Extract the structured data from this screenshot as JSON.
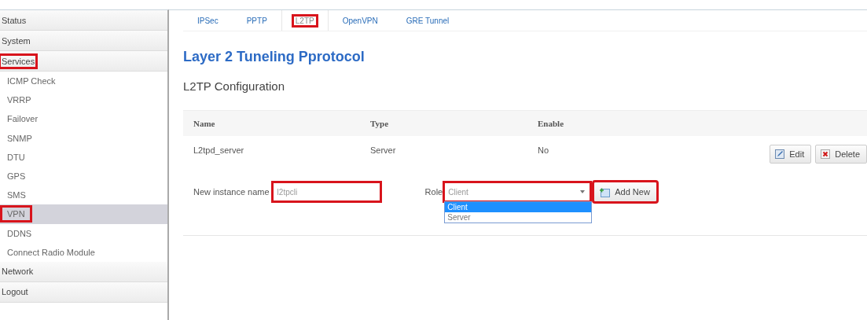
{
  "sidebar": {
    "items": [
      {
        "label": "Status",
        "selected": false,
        "highlighted": false
      },
      {
        "label": "System",
        "selected": false,
        "highlighted": false
      },
      {
        "label": "Services",
        "selected": false,
        "highlighted": true,
        "children": [
          {
            "label": "ICMP Check",
            "selected": false,
            "highlighted": false
          },
          {
            "label": "VRRP",
            "selected": false,
            "highlighted": false
          },
          {
            "label": "Failover",
            "selected": false,
            "highlighted": false
          },
          {
            "label": "SNMP",
            "selected": false,
            "highlighted": false
          },
          {
            "label": "DTU",
            "selected": false,
            "highlighted": false
          },
          {
            "label": "GPS",
            "selected": false,
            "highlighted": false
          },
          {
            "label": "SMS",
            "selected": false,
            "highlighted": false
          },
          {
            "label": "VPN",
            "selected": true,
            "highlighted": true
          },
          {
            "label": "DDNS",
            "selected": false,
            "highlighted": false
          },
          {
            "label": "Connect Radio Module",
            "selected": false,
            "highlighted": false
          }
        ]
      },
      {
        "label": "Network",
        "selected": false,
        "highlighted": false
      },
      {
        "label": "Logout",
        "selected": false,
        "highlighted": false
      }
    ]
  },
  "tabs": [
    {
      "label": "IPSec",
      "selected": false,
      "highlighted": false
    },
    {
      "label": "PPTP",
      "selected": false,
      "highlighted": false
    },
    {
      "label": "L2TP",
      "selected": true,
      "highlighted": true
    },
    {
      "label": "OpenVPN",
      "selected": false,
      "highlighted": false
    },
    {
      "label": "GRE Tunnel",
      "selected": false,
      "highlighted": false
    }
  ],
  "title": "Layer 2 Tuneling Pprotocol",
  "subtitle": "L2TP Configuration",
  "table": {
    "columns": [
      "Name",
      "Type",
      "Enable"
    ],
    "rows": [
      {
        "cells": [
          "L2tpd_server",
          "Server",
          "No"
        ],
        "actions": [
          {
            "kind": "edit",
            "label": "Edit"
          },
          {
            "kind": "delete",
            "label": "Delete"
          }
        ]
      }
    ]
  },
  "new_instance": {
    "label": "New instance name",
    "value": "l2tpcli",
    "highlighted": true,
    "role_label": "Role",
    "role": {
      "value": "Client",
      "expanded": true,
      "highlighted": true,
      "options": [
        {
          "label": "Client",
          "selected": true
        },
        {
          "label": "Server",
          "selected": false
        }
      ]
    },
    "add_button": {
      "label": "Add New",
      "highlighted": true
    }
  }
}
